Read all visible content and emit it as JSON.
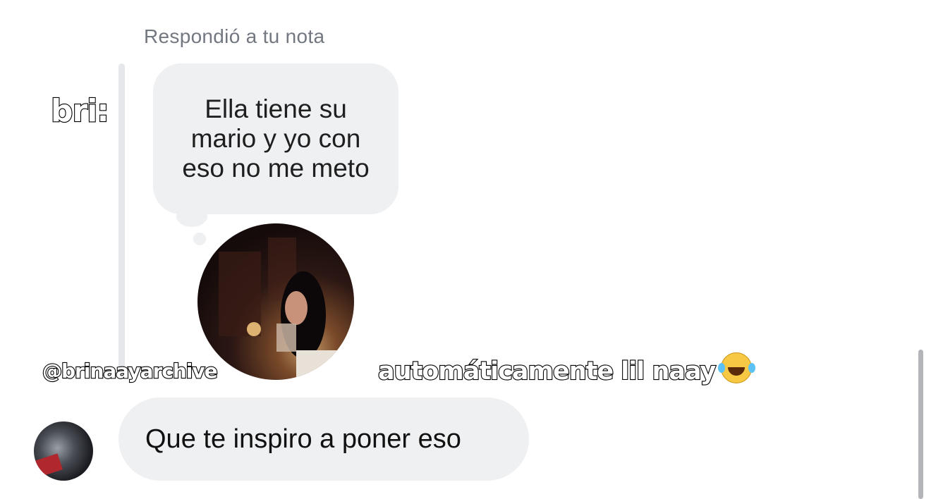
{
  "reply_header": "Respondió a tu nota",
  "note": {
    "text": "Ella tiene su mario y yo con eso no me meto"
  },
  "overlays": {
    "sender": "bri:",
    "handle": "@brinaayarchive",
    "caption": "automáticamente lil naay"
  },
  "message": {
    "text": "Que te inspiro a poner eso"
  },
  "icons": {
    "caption_emoji": "laughing-tears-emoji-icon"
  },
  "colors": {
    "bubble": "#eff0f2",
    "header_text": "#737880"
  }
}
